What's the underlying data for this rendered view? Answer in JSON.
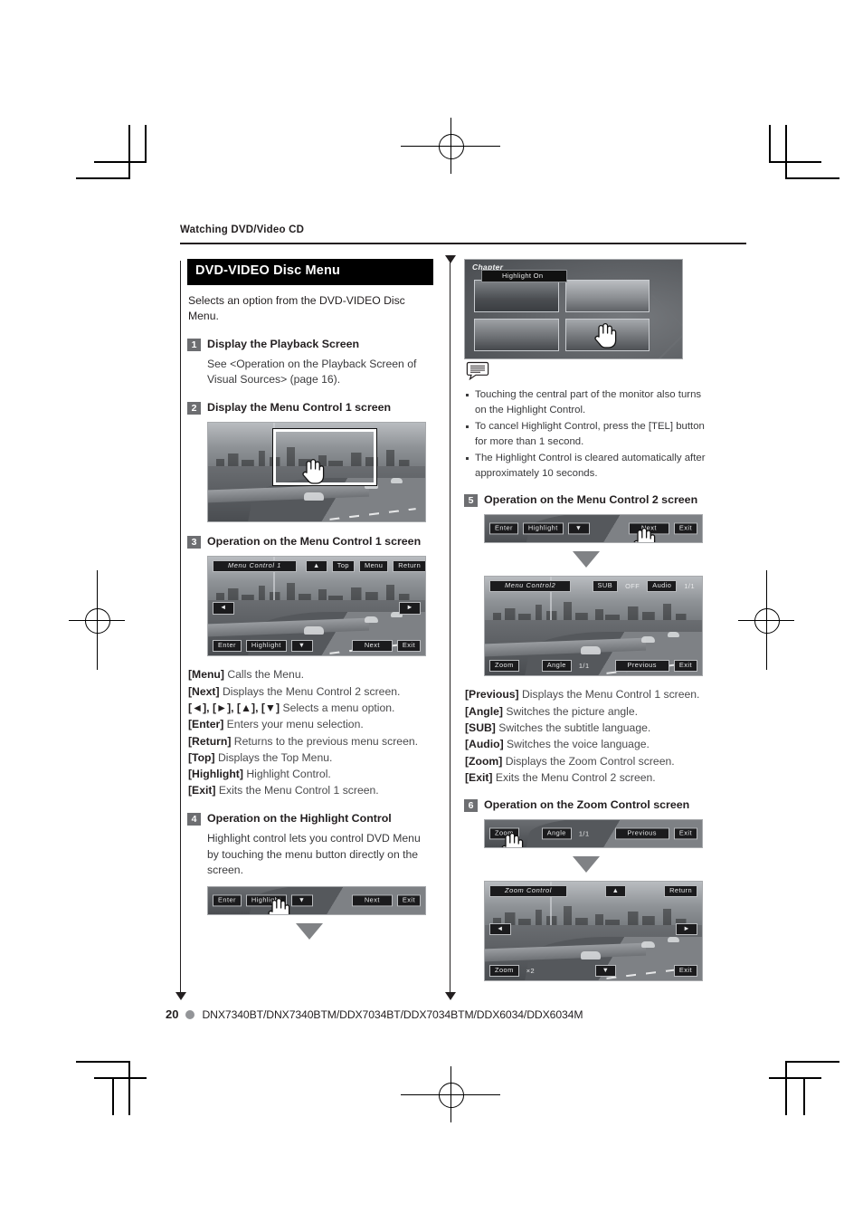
{
  "running_head": "Watching DVD/Video CD",
  "section": {
    "title": "DVD-VIDEO Disc Menu",
    "lede": "Selects an option from the DVD-VIDEO Disc Menu."
  },
  "steps": {
    "s1": {
      "num": "1",
      "title": "Display the Playback Screen",
      "body": "See <Operation on the Playback Screen of Visual Sources> (page 16)."
    },
    "s2": {
      "num": "2",
      "title": "Display the Menu Control 1 screen"
    },
    "s3": {
      "num": "3",
      "title": "Operation on the Menu Control 1 screen"
    },
    "s4": {
      "num": "4",
      "title": "Operation on the Highlight Control",
      "body": "Highlight control lets you control DVD Menu by touching the menu button directly on the screen."
    },
    "s5": {
      "num": "5",
      "title": "Operation on the Menu Control 2 screen"
    },
    "s6": {
      "num": "6",
      "title": "Operation on the Zoom Control screen"
    }
  },
  "menu_control_1": {
    "title": "Menu Control 1",
    "up": "▲",
    "down": "▼",
    "left": "◄",
    "right": "►",
    "top": "Top",
    "menu": "Menu",
    "return": "Return",
    "enter": "Enter",
    "highlight": "Highlight",
    "next": "Next",
    "exit": "Exit"
  },
  "menu_control_2": {
    "title": "Menu Control2",
    "sub_label": "SUB",
    "sub_value": "OFF",
    "audio_label": "Audio",
    "audio_value": "1/1",
    "zoom": "Zoom",
    "angle_label": "Angle",
    "angle_value": "1/1",
    "previous": "Previous",
    "exit": "Exit"
  },
  "zoom_control": {
    "title": "Zoom Control",
    "up": "▲",
    "down": "▼",
    "left": "◄",
    "right": "►",
    "return": "Return",
    "zoom_label": "Zoom",
    "zoom_value": "×2",
    "exit": "Exit"
  },
  "highlight_bar": {
    "enter": "Enter",
    "highlight": "Highlight",
    "down": "▼",
    "next": "Next",
    "exit": "Exit"
  },
  "zoom_bar": {
    "zoom": "Zoom",
    "angle_label": "Angle",
    "angle_value": "1/1",
    "previous": "Previous",
    "exit": "Exit"
  },
  "chapter_screen": {
    "title": "Chapter",
    "highlight_on": "Highlight On"
  },
  "defs_control_1": [
    {
      "key": "[Menu]",
      "desc": "Calls the Menu."
    },
    {
      "key": "[Next]",
      "desc": "Displays the Menu Control 2 screen."
    },
    {
      "key": "[◄], [►], [▲], [▼]",
      "desc": "Selects a menu option."
    },
    {
      "key": "[Enter]",
      "desc": "Enters your menu selection."
    },
    {
      "key": "[Return]",
      "desc": "Returns to the previous menu screen."
    },
    {
      "key": "[Top]",
      "desc": "Displays the Top Menu."
    },
    {
      "key": "[Highlight]",
      "desc": "Highlight Control."
    },
    {
      "key": "[Exit]",
      "desc": "Exits the Menu Control 1 screen."
    }
  ],
  "defs_control_2": [
    {
      "key": "[Previous]",
      "desc": "Displays the Menu Control 1 screen."
    },
    {
      "key": "[Angle]",
      "desc": "Switches the picture angle."
    },
    {
      "key": "[SUB]",
      "desc": "Switches the subtitle language."
    },
    {
      "key": "[Audio]",
      "desc": "Switches the voice language."
    },
    {
      "key": "[Zoom]",
      "desc": "Displays the Zoom Control screen."
    },
    {
      "key": "[Exit]",
      "desc": "Exits the Menu Control 2 screen."
    }
  ],
  "notes": [
    "Touching the central part of the monitor also turns on the Highlight Control.",
    "To cancel Highlight Control, press the [TEL] button for more than 1 second.",
    "The Highlight Control is cleared automatically after approximately 10 seconds."
  ],
  "footer": {
    "page_number": "20",
    "models": "DNX7340BT/DNX7340BTM/DDX7034BT/DDX7034BTM/DDX6034/DDX6034M"
  }
}
